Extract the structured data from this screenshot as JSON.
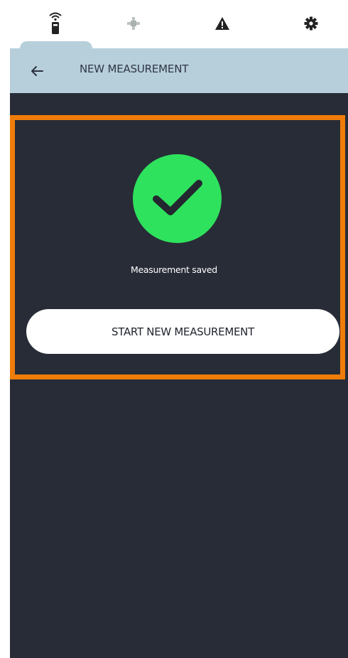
{
  "tabs": [
    {
      "icon": "remote-sensor-icon",
      "active": true
    },
    {
      "icon": "crosshair-icon",
      "active": false
    },
    {
      "icon": "warning-icon",
      "active": false
    },
    {
      "icon": "gear-icon",
      "active": false
    }
  ],
  "header": {
    "title": "NEW MEASUREMENT",
    "back_icon": "arrow-left-icon"
  },
  "result": {
    "icon": "checkmark-icon",
    "message": "Measurement saved"
  },
  "actions": {
    "start_new_label": "START NEW MEASUREMENT"
  },
  "colors": {
    "header_bg": "#b7cfda",
    "content_bg": "#282c37",
    "success_green": "#2fe25d",
    "highlight_orange": "#f07d0a",
    "button_bg": "#ffffff"
  }
}
